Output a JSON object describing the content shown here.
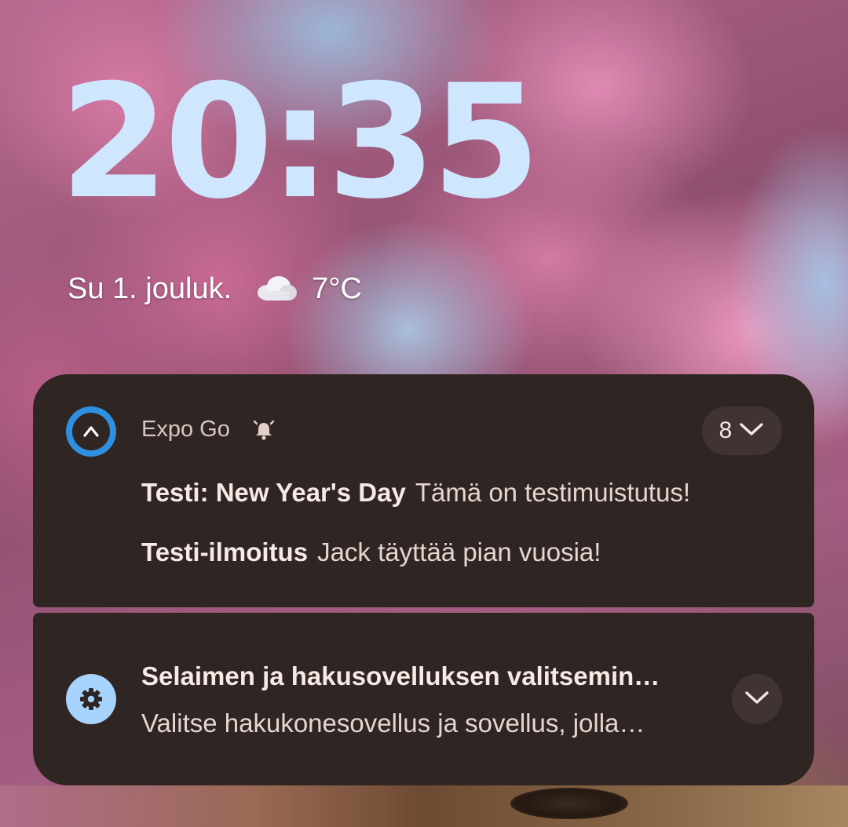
{
  "lockscreen": {
    "time": "20:35",
    "date": "Su 1. jouluk.",
    "weather_icon": "cloud-icon",
    "temperature": "7°C"
  },
  "notifications": {
    "expo": {
      "app_name": "Expo Go",
      "app_icon": "expo-icon",
      "alert_icon": "bell-icon",
      "count": "8",
      "messages": [
        {
          "title": "Testi: New Year's Day",
          "text": "Tämä on testimuistutus!"
        },
        {
          "title": "Testi-ilmoitus",
          "text": "Jack täyttää pian vuosia!"
        }
      ]
    },
    "settings": {
      "app_icon": "gear-icon",
      "title": "Selaimen ja hakusovelluksen valitsemin…",
      "text": "Valitse hakukonesovellus ja sovellus, jolla…"
    }
  },
  "colors": {
    "clock": "#cfe6ff",
    "card_background": "#2f2523",
    "expo_accent": "#2f8fe0",
    "settings_accent": "#a7d3ff"
  }
}
